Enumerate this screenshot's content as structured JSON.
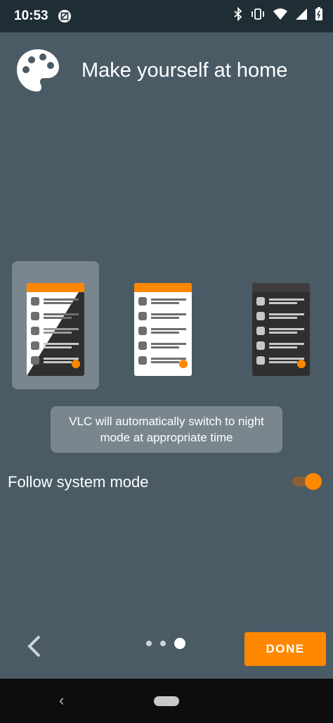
{
  "status_bar": {
    "time": "10:53",
    "icons": [
      "screenshot-icon",
      "bluetooth-icon",
      "vibrate-icon",
      "wifi-icon",
      "signal-icon",
      "battery-icon"
    ]
  },
  "header": {
    "title": "Make yourself at home",
    "icon": "palette-icon"
  },
  "themes": [
    {
      "name": "auto",
      "selected": true
    },
    {
      "name": "light",
      "selected": false
    },
    {
      "name": "dark",
      "selected": false
    }
  ],
  "tooltip": {
    "line1": "VLC will automatically switch to night",
    "line2": "mode at appropriate time"
  },
  "follow_system": {
    "label": "Follow system mode",
    "enabled": true
  },
  "footer": {
    "done_label": "DONE",
    "page_index": 3,
    "page_count": 3
  },
  "colors": {
    "background": "#4a5b66",
    "accent": "#ff8800",
    "selected_card": "#7a868e"
  }
}
